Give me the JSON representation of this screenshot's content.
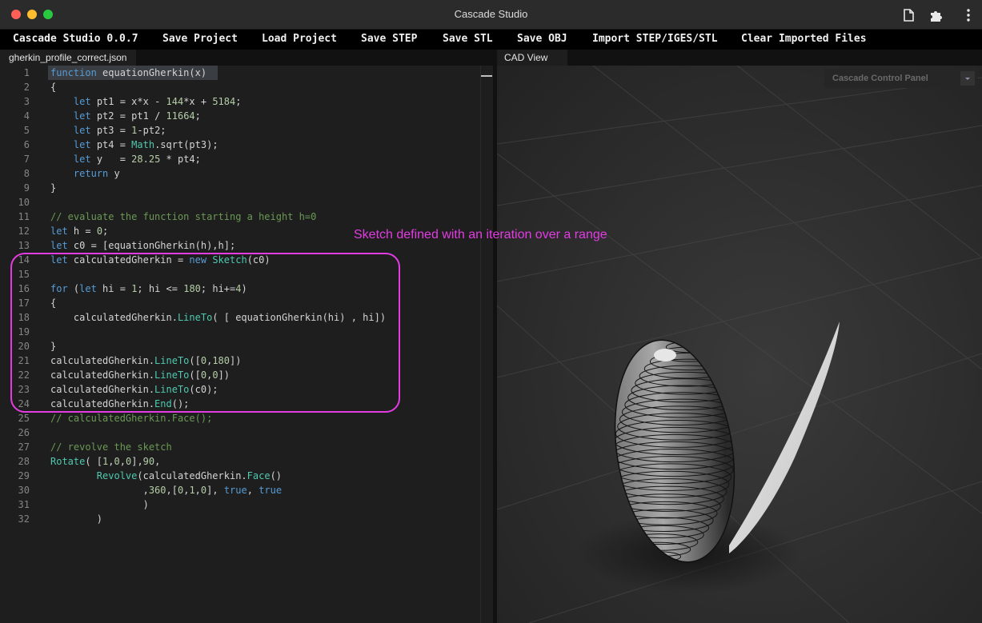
{
  "window": {
    "title": "Cascade Studio"
  },
  "menu": {
    "items": [
      "Cascade Studio 0.0.7",
      "Save Project",
      "Load Project",
      "Save STEP",
      "Save STL",
      "Save OBJ",
      "Import STEP/IGES/STL",
      "Clear Imported Files"
    ]
  },
  "editor": {
    "tab_label": "gherkin_profile_correct.json",
    "lines": [
      "function equationGherkin(x)",
      "{",
      "    let pt1 = x*x - 144*x + 5184;",
      "    let pt2 = pt1 / 11664;",
      "    let pt3 = 1-pt2;",
      "    let pt4 = Math.sqrt(pt3);",
      "    let y   = 28.25 * pt4;",
      "    return y",
      "}",
      "",
      "// evaluate the function starting a height h=0",
      "let h = 0;",
      "let c0 = [equationGherkin(h),h];",
      "let calculatedGherkin = new Sketch(c0)",
      "",
      "for (let hi = 1; hi <= 180; hi+=4)",
      "{",
      "    calculatedGherkin.LineTo( [ equationGherkin(hi) , hi])",
      "",
      "}",
      "calculatedGherkin.LineTo([0,180])",
      "calculatedGherkin.LineTo([0,0])",
      "calculatedGherkin.LineTo(c0);",
      "calculatedGherkin.End();",
      "// calculatedGherkin.Face();",
      "",
      "// revolve the sketch",
      "Rotate( [1,0,0],90,",
      "        Revolve(calculatedGherkin.Face()",
      "                ,360,[0,1,0], true, true",
      "                )",
      "        )"
    ]
  },
  "cad_view": {
    "tab_label": "CAD View",
    "control_panel_label": "Cascade Control Panel"
  },
  "annotation": {
    "text": "Sketch defined with an iteration over a range",
    "color": "#e33ce3"
  },
  "colors": {
    "keyword": "#569cd6",
    "function": "#4ec9b0",
    "number": "#b5cea8",
    "comment": "#6a9955"
  },
  "icons": [
    "document-icon",
    "puzzle-extension-icon",
    "more-vertical-icon"
  ]
}
